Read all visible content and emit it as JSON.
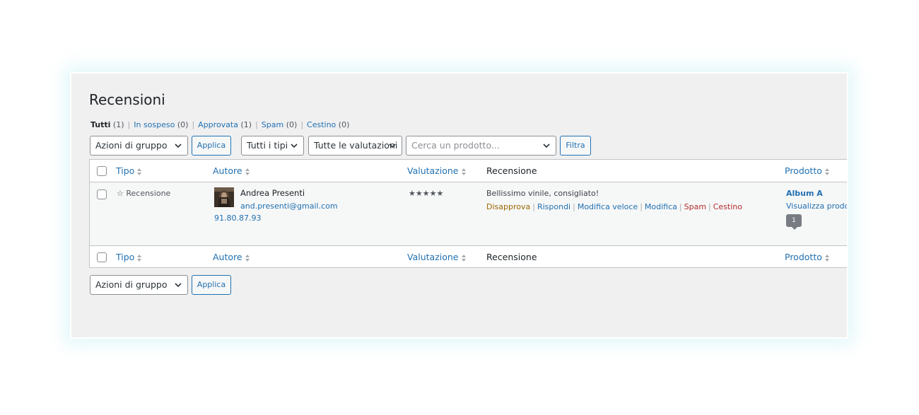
{
  "page": {
    "title": "Recensioni"
  },
  "filters": {
    "views": [
      {
        "label": "Tutti",
        "count": "(1)",
        "current": true
      },
      {
        "label": "In sospeso",
        "count": "(0)"
      },
      {
        "label": "Approvata",
        "count": "(1)"
      },
      {
        "label": "Spam",
        "count": "(0)"
      },
      {
        "label": "Cestino",
        "count": "(0)"
      }
    ],
    "separator": "|"
  },
  "toolbar_top": {
    "bulk_actions": "Azioni di gruppo",
    "apply": "Applica",
    "type_filter": "Tutti i tipi",
    "rating_filter": "Tutte le valutazioni",
    "product_search_placeholder": "Cerca un prodotto...",
    "filter_button": "Filtra"
  },
  "table": {
    "columns": {
      "type": "Tipo",
      "author": "Autore",
      "rating": "Valutazione",
      "review": "Recensione",
      "product": "Prodotto"
    },
    "rows": [
      {
        "type": "☆ Recensione",
        "author_name": "Andrea Presenti",
        "author_email": "and.presenti@gmail.com",
        "author_ip": "91.80.87.93",
        "rating_stars": "★★★★★",
        "rating_value": 5,
        "review_text": "Bellissimo vinile, consigliato!",
        "actions": {
          "unapprove": "Disapprova",
          "reply": "Rispondi",
          "quick_edit": "Modifica veloce",
          "edit": "Modifica",
          "spam": "Spam",
          "trash": "Cestino"
        },
        "product_name": "Album A",
        "product_view": "Visualizza prodotto",
        "review_count": "1"
      }
    ]
  },
  "toolbar_bottom": {
    "bulk_actions": "Azioni di gruppo",
    "apply": "Applica"
  },
  "colors": {
    "link": "#2271b1",
    "unapprove": "#996800",
    "delete": "#b32d2e",
    "background": "#f0f0f1"
  }
}
